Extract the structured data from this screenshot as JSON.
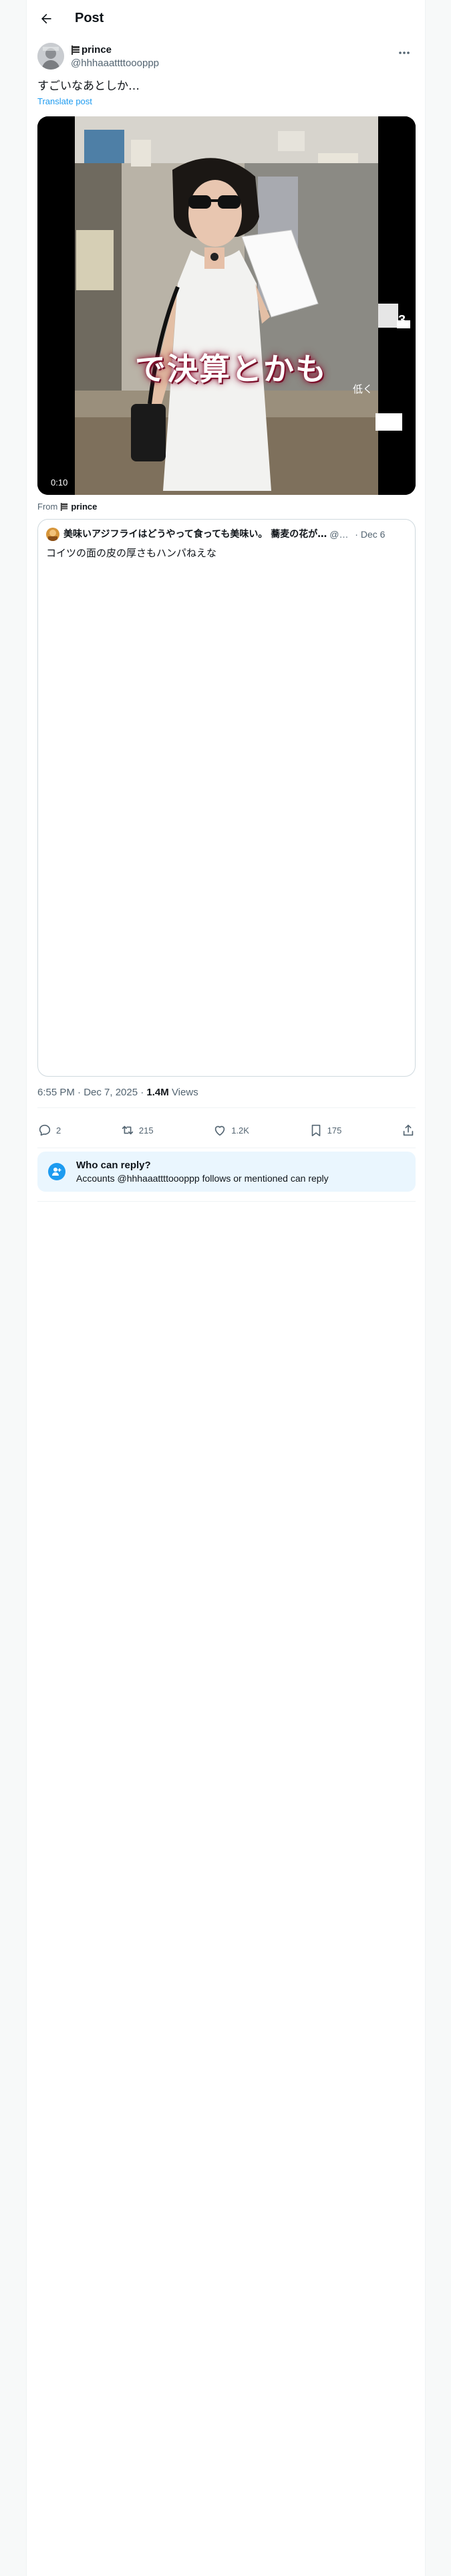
{
  "header": {
    "back_icon": "arrow-left-icon",
    "title": "Post"
  },
  "tweet": {
    "author_name": "prince",
    "author_handle": "@hhhaaattttoooppp",
    "more_icon": "more-icon",
    "text": "すごいなあとしか…",
    "translate_label": "Translate post",
    "video": {
      "elapsed": "0:10",
      "caption": "で決算とかも",
      "side_glyphs": [
        "3",
        "低く"
      ]
    },
    "from_label": "From",
    "from_name": "prince",
    "quote": {
      "author_name": "美味いアジフライはどうやって食っても美味い。 蕎麦の花が…",
      "author_handle": "@B…",
      "separator": "·",
      "date": "Dec 6",
      "text": "コイツの面の皮の厚さもハンパねえな"
    },
    "timestamp": "6:55 PM · Dec 7, 2025 ·",
    "views_count": "1.4M",
    "views_label": "Views",
    "actions": {
      "replies": "2",
      "reposts": "215",
      "likes": "1.2K",
      "bookmarks": "175"
    }
  },
  "reply_settings": {
    "title": "Who can reply?",
    "description": "Accounts @hhhaaattttoooppp follows or mentioned can reply",
    "icon": "person-add-icon"
  },
  "colors": {
    "accent": "#1d9bf0",
    "text": "#0f1419",
    "secondary": "#536471",
    "border": "#cfd9de",
    "reply_bg": "#eaf6fe"
  }
}
